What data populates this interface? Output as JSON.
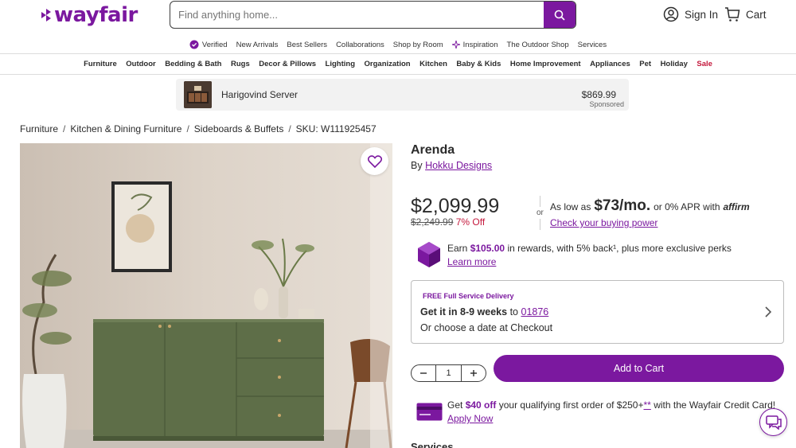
{
  "header": {
    "logo": "wayfair",
    "search_placeholder": "Find anything home...",
    "sign_in": "Sign In",
    "cart": "Cart"
  },
  "util_nav": [
    "Verified",
    "New Arrivals",
    "Best Sellers",
    "Collaborations",
    "Shop by Room",
    "Inspiration",
    "The Outdoor Shop",
    "Services"
  ],
  "category_nav": [
    "Furniture",
    "Outdoor",
    "Bedding & Bath",
    "Rugs",
    "Decor & Pillows",
    "Lighting",
    "Organization",
    "Kitchen",
    "Baby & Kids",
    "Home Improvement",
    "Appliances",
    "Pet",
    "Holiday",
    "Sale"
  ],
  "banner": {
    "name": "Harigovind Server",
    "price": "$869.99",
    "sponsored": "Sponsored"
  },
  "breadcrumb": {
    "items": [
      "Furniture",
      "Kitchen & Dining Furniture",
      "Sideboards & Buffets"
    ],
    "sku": "SKU: W111925457"
  },
  "product": {
    "title": "Arenda",
    "by": "By",
    "brand": "Hokku Designs",
    "price": "$2,099.99",
    "was_price": "$2,249.99",
    "discount": "7% Off",
    "or": "or",
    "as_low_as": "As low as",
    "monthly": "$73/mo.",
    "apr": "or 0% APR with",
    "affirm": "affirm",
    "check_power": "Check your buying power",
    "rewards_prefix": "Earn",
    "rewards_amount": "$105.00",
    "rewards_suffix": "in rewards, with 5% back¹, plus more exclusive perks",
    "learn_more": "Learn more"
  },
  "delivery": {
    "label": "FREE Full Service Delivery",
    "eta_prefix": "Get it in",
    "eta_weeks": "8-9 weeks",
    "eta_to": "to",
    "zip": "01876",
    "choose": "Or choose a date at Checkout"
  },
  "purchase": {
    "quantity": "1",
    "add_to_cart": "Add to Cart"
  },
  "credit": {
    "prefix": "Get",
    "amount": "$40 off",
    "middle": "your qualifying first order of $250+",
    "stars": "**",
    "suffix": "with the Wayfair Credit Card!",
    "apply": "Apply Now"
  },
  "services_heading": "Services",
  "colors": {
    "brand": "#7b189f",
    "sale": "#c4183c"
  }
}
